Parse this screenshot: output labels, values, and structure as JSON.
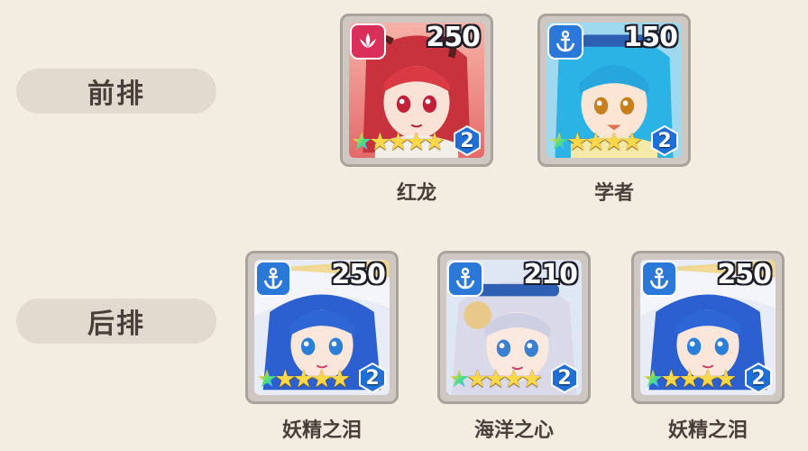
{
  "rows": {
    "front_label": "前排",
    "back_label": "后排"
  },
  "front": [
    {
      "name": "红龙",
      "power": "250",
      "level": "2",
      "stars": 5,
      "faction_icon": "lotus-icon",
      "badge_color": "#d92f5a"
    },
    {
      "name": "学者",
      "power": "150",
      "level": "2",
      "stars": 5,
      "faction_icon": "anchor-icon",
      "badge_color": "#2a78d8"
    }
  ],
  "back": [
    {
      "name": "妖精之泪",
      "power": "250",
      "level": "2",
      "stars": 5,
      "faction_icon": "anchor-icon",
      "badge_color": "#2a78d8"
    },
    {
      "name": "海洋之心",
      "power": "210",
      "level": "2",
      "stars": 5,
      "faction_icon": "anchor-icon",
      "badge_color": "#2a78d8"
    },
    {
      "name": "妖精之泪",
      "power": "250",
      "level": "2",
      "stars": 5,
      "faction_icon": "anchor-icon",
      "badge_color": "#2a78d8"
    }
  ],
  "colors": {
    "background": "#f3ece0",
    "label_pill": "#e2d9cf",
    "text": "#4a3f3a",
    "level_hex": "#1f6fd6"
  }
}
